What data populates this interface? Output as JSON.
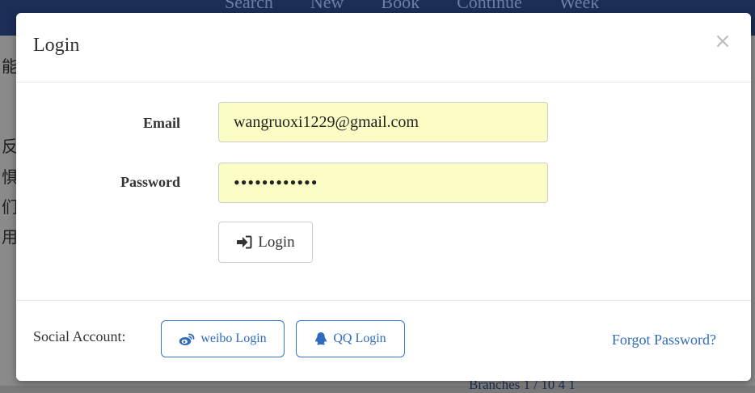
{
  "background": {
    "nav_items": [
      "Search",
      "New",
      "Book",
      "Continue",
      "Week"
    ],
    "left_glyphs": [
      "能",
      "反",
      "惧",
      "们",
      "用"
    ],
    "footer_text": "Branches 1 / 10 4 1"
  },
  "modal": {
    "title": "Login",
    "close_label": "×",
    "email": {
      "label": "Email",
      "value": "wangruoxi1229@gmail.com"
    },
    "password": {
      "label": "Password",
      "value": "••••••••••••"
    },
    "login_button": "Login",
    "social_label": "Social Account:",
    "weibo_button": "weibo Login",
    "qq_button": "QQ Login",
    "forgot_link": "Forgot Password?"
  },
  "colors": {
    "navbar": "#1b2e57",
    "input_autofill": "#fbfdc4",
    "link_blue": "#2e6bbd"
  }
}
